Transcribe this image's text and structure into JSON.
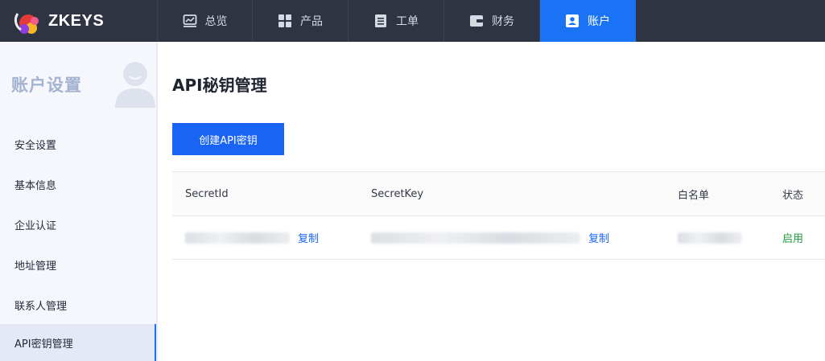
{
  "brand": {
    "name": "ZKEYS",
    "colors": {
      "nav_bg": "#2e3442",
      "accent": "#1a73f5",
      "success": "#1a9a3a"
    }
  },
  "nav": {
    "items": [
      {
        "label": "总览",
        "icon": "dashboard-chart-icon",
        "active": false
      },
      {
        "label": "产品",
        "icon": "grid-icon",
        "active": false
      },
      {
        "label": "工单",
        "icon": "document-icon",
        "active": false
      },
      {
        "label": "财务",
        "icon": "wallet-icon",
        "active": false
      },
      {
        "label": "账户",
        "icon": "user-badge-icon",
        "active": true
      }
    ]
  },
  "sidebar": {
    "title": "账户设置",
    "avatar_icon": "user-avatar-icon",
    "items": [
      {
        "label": "安全设置",
        "active": false
      },
      {
        "label": "基本信息",
        "active": false
      },
      {
        "label": "企业认证",
        "active": false
      },
      {
        "label": "地址管理",
        "active": false
      },
      {
        "label": "联系人管理",
        "active": false
      },
      {
        "label": "API密钥管理",
        "active": true
      }
    ]
  },
  "main": {
    "title": "API秘钥管理",
    "create_button": "创建API密钥",
    "table": {
      "headers": [
        "SecretId",
        "SecretKey",
        "白名单",
        "状态"
      ],
      "rows": [
        {
          "secret_id_copy": "复制",
          "secret_key_copy": "复制",
          "status": "启用"
        }
      ]
    }
  }
}
